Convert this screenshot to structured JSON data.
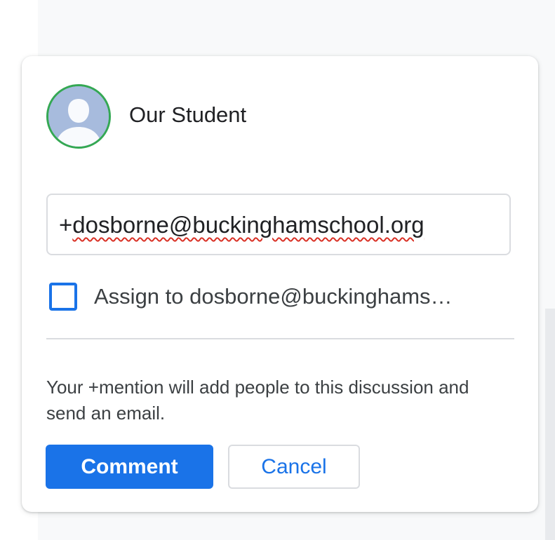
{
  "comment_card": {
    "author_name": "Our Student",
    "input": {
      "prefix": "+",
      "mention": "dosborne@buckinghamschool.org"
    },
    "assign_checkbox": {
      "checked": false,
      "label": "Assign to dosborne@buckinghamschool.org"
    },
    "hint": "Your +mention will add people to this discussion and send an email.",
    "comment_label": "Comment",
    "cancel_label": "Cancel"
  },
  "icons": {
    "avatar": "person-icon"
  },
  "colors": {
    "accent": "#1a73e8",
    "avatar_ring": "#34a853",
    "spellcheck": "#d93025"
  }
}
